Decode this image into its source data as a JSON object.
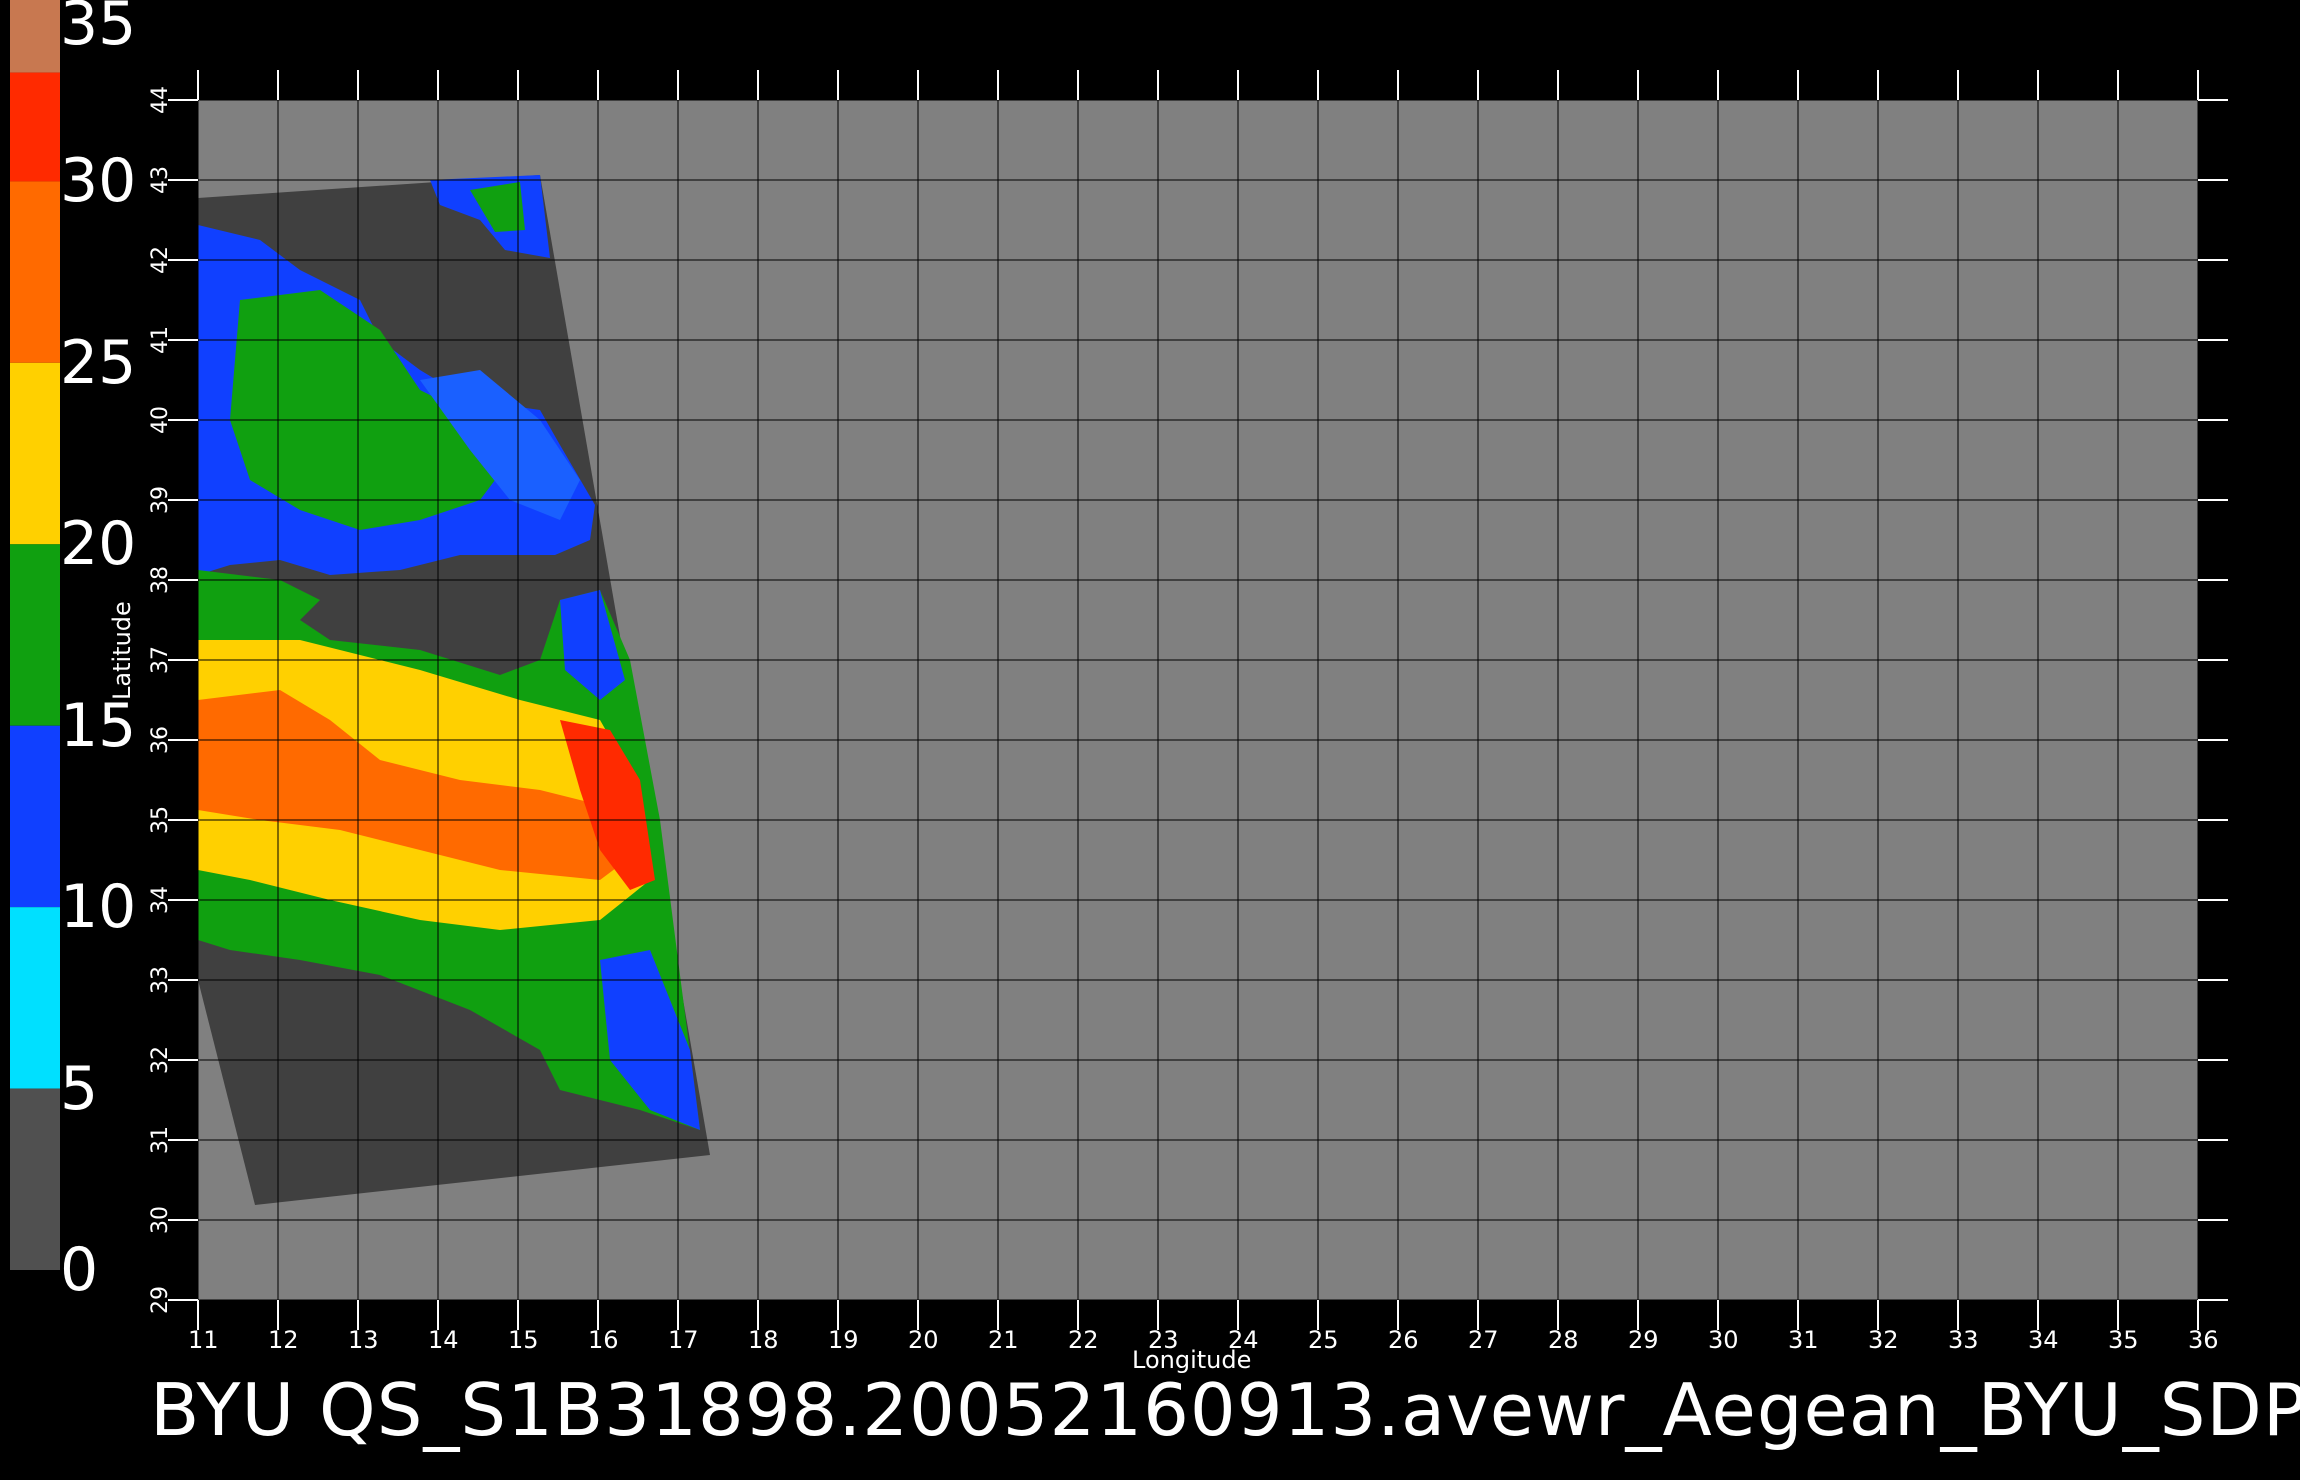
{
  "title": "BYU  QS_S1B31898.20052160913.avewr_Aegean_BYU_SDP",
  "map": {
    "xlabel": "Longitude",
    "ylabel": "Latitude",
    "lon_ticks": [
      11,
      12,
      13,
      14,
      15,
      16,
      17,
      18,
      19,
      20,
      21,
      22,
      23,
      24,
      25,
      26,
      27,
      28,
      29,
      30,
      31,
      32,
      33,
      34,
      35,
      36
    ],
    "lat_ticks": [
      29,
      30,
      31,
      32,
      33,
      34,
      35,
      36,
      37,
      38,
      39,
      40,
      41,
      42,
      43,
      44
    ],
    "lon_range": [
      11,
      36
    ],
    "lat_range": [
      29,
      44
    ],
    "grid": true,
    "background_color": "#808080",
    "land_color": "#404040"
  },
  "colorbar": {
    "labels": [
      "35",
      "30",
      "25",
      "20",
      "15",
      "10",
      "5",
      "0"
    ],
    "bands": [
      {
        "from": 33,
        "to": 35,
        "color": "#c87850"
      },
      {
        "from": 30,
        "to": 33,
        "color": "#ff2a00"
      },
      {
        "from": 25,
        "to": 30,
        "color": "#ff6a00"
      },
      {
        "from": 20,
        "to": 25,
        "color": "#ffd000"
      },
      {
        "from": 15,
        "to": 20,
        "color": "#10a010"
      },
      {
        "from": 10,
        "to": 15,
        "color": "#1040ff"
      },
      {
        "from": 5,
        "to": 10,
        "color": "#00e0ff"
      },
      {
        "from": 0,
        "to": 5,
        "color": "#505050"
      }
    ]
  }
}
